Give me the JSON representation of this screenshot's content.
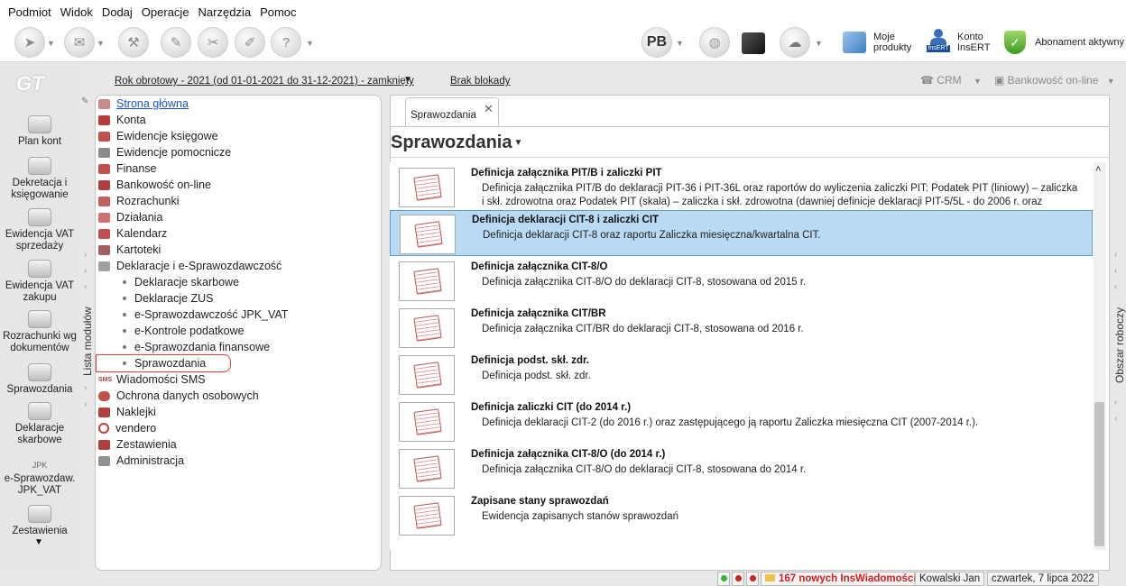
{
  "menu": [
    "Podmiot",
    "Widok",
    "Dodaj",
    "Operacje",
    "Narzędzia",
    "Pomoc"
  ],
  "toolbar": {
    "pb_label": "PB",
    "moje_produkty": [
      "Moje",
      "produkty"
    ],
    "konto": [
      "Konto",
      "InsERT"
    ],
    "konto_icon_caption": "InsERT",
    "abonament": "Abonament aktywny"
  },
  "brand_logo": "GT",
  "topbar": {
    "rok_obrotowy": "Rok obrotowy - 2021  (od 01-01-2021 do 31-12-2021) - zamknięty",
    "brak_blokady": "Brak blokady",
    "crm": "CRM",
    "bankowosc": "Bankowość on-line"
  },
  "sidebar": {
    "items": [
      {
        "label": "Plan kont"
      },
      {
        "label": "Dekretacja i księgowanie"
      },
      {
        "label": "Ewidencja VAT sprzedaży"
      },
      {
        "label": "Ewidencja VAT zakupu"
      },
      {
        "label": "Rozrachunki wg dokumentów"
      },
      {
        "label": "Sprawozdania"
      },
      {
        "label": "Deklaracje skarbowe"
      },
      {
        "label": "e-Sprawozdaw. JPK_VAT"
      },
      {
        "label": "Zestawienia"
      }
    ],
    "jpk_icon_label": "JPK"
  },
  "modules_tab": "Lista modułów",
  "tree": {
    "items": [
      {
        "label": "Strona główna",
        "color": "#c98a8a"
      },
      {
        "label": "Konta",
        "color": "#b53d3d"
      },
      {
        "label": "Ewidencje księgowe",
        "color": "#c05050"
      },
      {
        "label": "Ewidencje pomocnicze",
        "color": "#8a8a8a"
      },
      {
        "label": "Finanse",
        "color": "#c0504d"
      },
      {
        "label": "Bankowość on-line",
        "color": "#b04040"
      },
      {
        "label": "Rozrachunki",
        "color": "#c26060"
      },
      {
        "label": "Działania",
        "color": "#d07070"
      },
      {
        "label": "Kalendarz",
        "color": "#c05050"
      },
      {
        "label": "Kartoteki",
        "color": "#a06060"
      },
      {
        "label": "Deklaracje i e-Sprawozdawczość",
        "color": "#a0a0a0"
      }
    ],
    "subitems": [
      {
        "label": "Deklaracje skarbowe"
      },
      {
        "label": "Deklaracje ZUS"
      },
      {
        "label": "e-Sprawozdawczość JPK_VAT"
      },
      {
        "label": "e-Kontrole podatkowe"
      },
      {
        "label": "e-Sprawozdania finansowe"
      },
      {
        "label": "Sprawozdania"
      }
    ],
    "items2": [
      {
        "label": "Wiadomości SMS",
        "icon_text": "SMS"
      },
      {
        "label": "Ochrona danych osobowych",
        "color": "#c05050"
      },
      {
        "label": "Naklejki",
        "color": "#b04040"
      },
      {
        "label": "vendero",
        "color": "#c04040"
      },
      {
        "label": "Zestawienia",
        "color": "#b04040"
      },
      {
        "label": "Administracja",
        "color": "#909090"
      }
    ]
  },
  "main": {
    "tab_label": "Sprawozdania",
    "heading": "Sprawozdania",
    "rows": [
      {
        "title": "Definicja załącznika PIT/B i zaliczki PIT",
        "desc": "Definicja załącznika PIT/B do deklaracji PIT-36 i PIT-36L oraz raportów do wyliczenia zaliczki PIT: Podatek PIT (liniowy) – zaliczka i skł. zdrowotna oraz Podatek PIT (skala) – zaliczka i skł. zdrowotna (dawniej definicje deklaracji PIT-5/5L - do 2006 r. oraz"
      },
      {
        "title": "Definicja deklaracji CIT-8 i zaliczki CIT",
        "desc": "Definicja deklaracji CIT-8 oraz raportu Zaliczka miesięczna/kwartalna CIT."
      },
      {
        "title": "Definicja załącznika CIT-8/O",
        "desc": "Definicja załącznika CIT-8/O do deklaracji CIT-8, stosowana od 2015 r."
      },
      {
        "title": "Definicja załącznika CIT/BR",
        "desc": "Definicja załącznika CIT/BR do deklaracji CIT-8, stosowana od 2016 r."
      },
      {
        "title": "Definicja podst. skł. zdr.",
        "desc": "Definicja podst. skł. zdr."
      },
      {
        "title": "Definicja zaliczki CIT (do 2014 r.)",
        "desc": "Definicja deklaracji CIT-2 (do 2016 r.) oraz zastępującego ją raportu Zaliczka miesięczna CIT (2007-2014 r.)."
      },
      {
        "title": "Definicja załącznika CIT-8/O (do 2014 r.)",
        "desc": "Definicja załącznika CIT-8/O do deklaracji CIT-8, stosowana do 2014 r."
      },
      {
        "title": "Zapisane stany sprawozdań",
        "desc": "Ewidencja zapisanych stanów sprawozdań"
      }
    ],
    "selected_index": 1
  },
  "obszar_tab": "Obszar roboczy",
  "status": {
    "messages": "167 nowych InsWiadomości",
    "user": "Kowalski Jan",
    "date": "czwartek, 7 lipca 2022"
  },
  "colors": {
    "accent": "#5a9fd3",
    "selected_row": "#b9daf2",
    "link": "#1a56c9",
    "alert": "#d02020"
  }
}
